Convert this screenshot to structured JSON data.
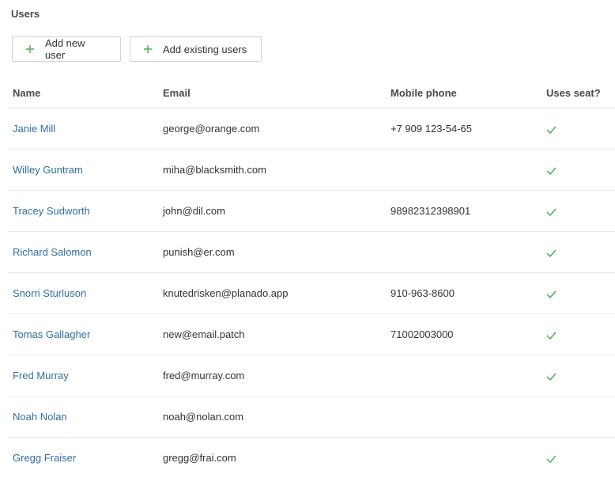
{
  "section": {
    "title": "Users"
  },
  "toolbar": {
    "add_new_label": "Add new user",
    "add_existing_label": "Add existing users",
    "plus_icon": "plus-icon"
  },
  "table": {
    "columns": [
      "Name",
      "Email",
      "Mobile phone",
      "Uses seat?"
    ],
    "rows": [
      {
        "name": "Janie Mill",
        "email": "george@orange.com",
        "phone": "+7 909 123-54-65",
        "uses_seat": true
      },
      {
        "name": "Willey Guntram",
        "email": "miha@blacksmith.com",
        "phone": "",
        "uses_seat": true
      },
      {
        "name": "Tracey Sudworth",
        "email": "john@dil.com",
        "phone": "98982312398901",
        "uses_seat": true
      },
      {
        "name": "Richard Salomon",
        "email": "punish@er.com",
        "phone": "",
        "uses_seat": true
      },
      {
        "name": "Snorri Sturluson",
        "email": "knutedrisken@planado.app",
        "phone": "910-963-8600",
        "uses_seat": true
      },
      {
        "name": "Tomas Gallagher",
        "email": "new@email.patch",
        "phone": "71002003000",
        "uses_seat": true
      },
      {
        "name": "Fred Murray",
        "email": "fred@murray.com",
        "phone": "",
        "uses_seat": true
      },
      {
        "name": "Noah Nolan",
        "email": "noah@nolan.com",
        "phone": "",
        "uses_seat": false
      },
      {
        "name": "Gregg Fraiser",
        "email": "gregg@frai.com",
        "phone": "",
        "uses_seat": true
      }
    ]
  },
  "colors": {
    "link": "#2f6ea6",
    "accent_green": "#4caf50",
    "border": "#d4d4d4"
  }
}
